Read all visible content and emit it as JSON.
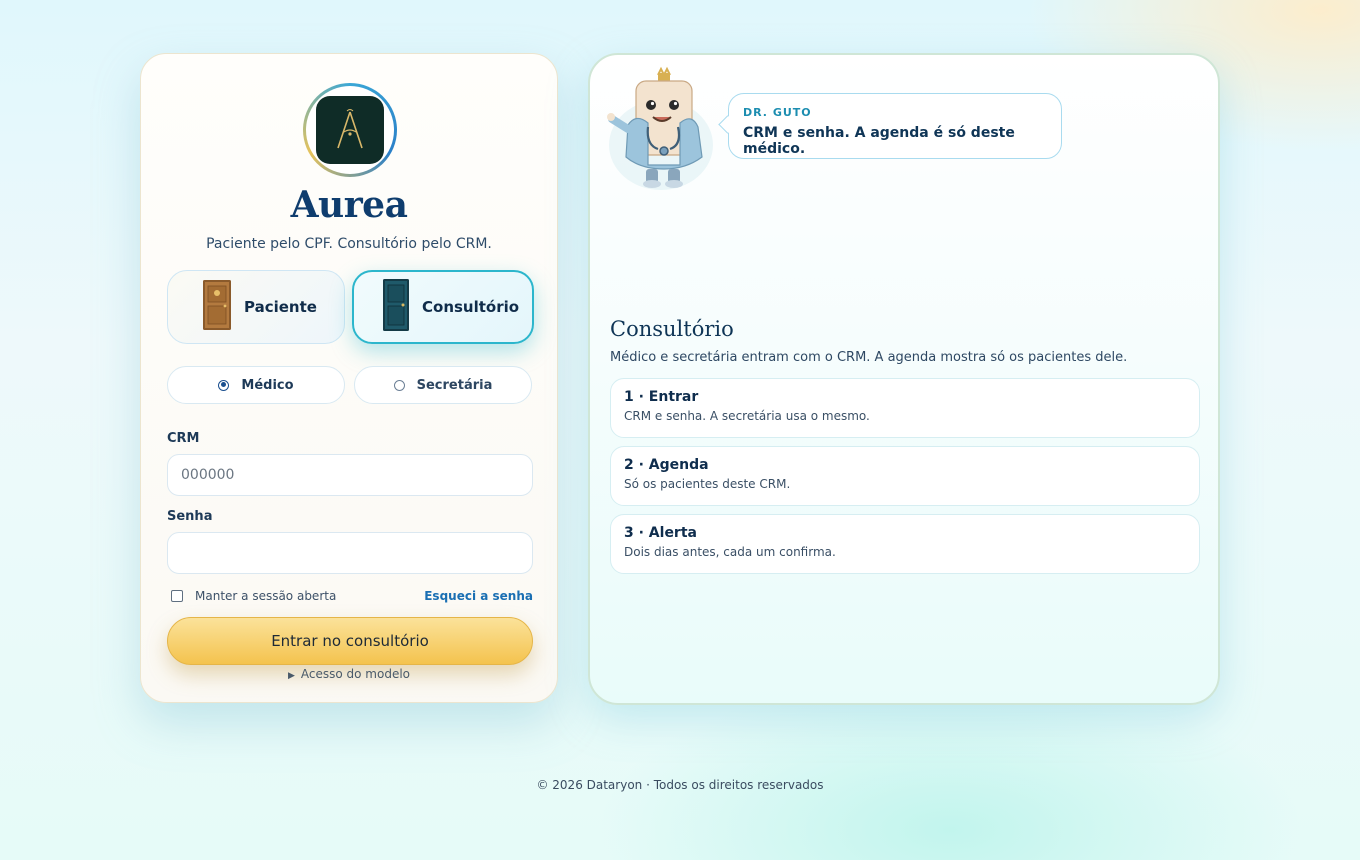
{
  "brand": {
    "name": "Aurea",
    "tagline": "Paciente pelo CPF. Consultório pelo CRM.",
    "logo_icon": "compass-a-logo"
  },
  "entry_type": {
    "options": [
      {
        "label": "Paciente",
        "icon": "wooden-door-icon",
        "selected": false
      },
      {
        "label": "Consultório",
        "icon": "teal-door-icon",
        "selected": true
      }
    ]
  },
  "role": {
    "options": [
      {
        "label": "Médico",
        "selected": true
      },
      {
        "label": "Secretária",
        "selected": false
      }
    ]
  },
  "form": {
    "crm_label": "CRM",
    "crm_placeholder": "000000",
    "crm_value": "",
    "password_label": "Senha",
    "password_value": "",
    "remember_label": "Manter a sessão aberta",
    "remember_checked": false,
    "forgot_label": "Esqueci a senha",
    "submit_label": "Entrar no consultório",
    "model_access_label": "Acesso do modelo"
  },
  "assistant": {
    "name": "DR. GUTO",
    "message": "CRM e senha. A agenda é só deste médico."
  },
  "info": {
    "title": "Consultório",
    "subtitle": "Médico e secretária entram com o CRM. A agenda mostra só os pacientes dele.",
    "steps": [
      {
        "title": "1 · Entrar",
        "description": "CRM e senha. A secretária usa o mesmo."
      },
      {
        "title": "2 · Agenda",
        "description": "Só os pacientes deste CRM."
      },
      {
        "title": "3 · Alerta",
        "description": "Dois dias antes, cada um confirma."
      }
    ]
  },
  "footer": {
    "text": "© 2026 Dataryon · Todos os direitos reservados"
  },
  "colors": {
    "accent_teal": "#2cb6cc",
    "button_gold": "#f4c34e",
    "brand_navy": "#0f3d6e",
    "link_blue": "#1a6fb3"
  }
}
